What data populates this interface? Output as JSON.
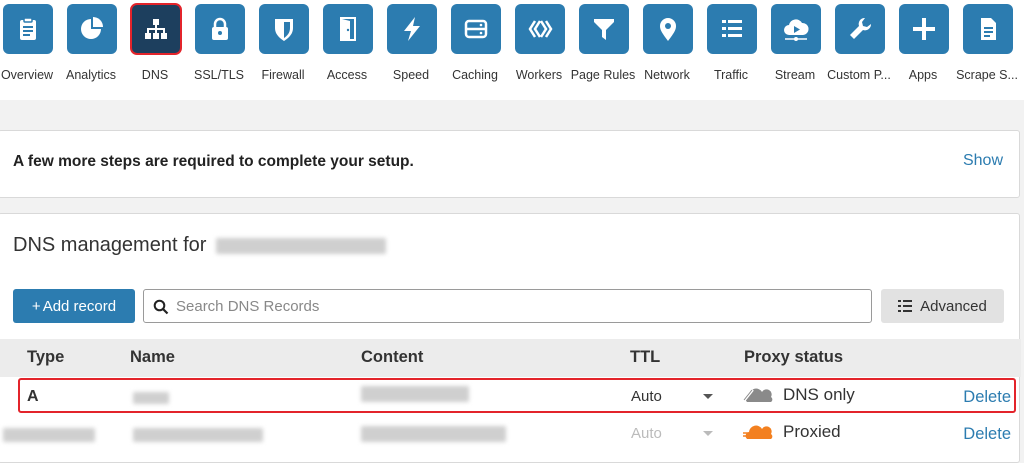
{
  "nav": {
    "items": [
      {
        "label": "Overview",
        "icon": "clipboard-icon"
      },
      {
        "label": "Analytics",
        "icon": "pie-chart-icon"
      },
      {
        "label": "DNS",
        "icon": "sitemap-icon",
        "active": true
      },
      {
        "label": "SSL/TLS",
        "icon": "lock-icon"
      },
      {
        "label": "Firewall",
        "icon": "shield-icon"
      },
      {
        "label": "Access",
        "icon": "door-icon"
      },
      {
        "label": "Speed",
        "icon": "lightning-icon"
      },
      {
        "label": "Caching",
        "icon": "server-icon"
      },
      {
        "label": "Workers",
        "icon": "workers-icon"
      },
      {
        "label": "Page Rules",
        "icon": "filter-icon"
      },
      {
        "label": "Network",
        "icon": "location-pin-icon"
      },
      {
        "label": "Traffic",
        "icon": "list-icon"
      },
      {
        "label": "Stream",
        "icon": "cloud-play-icon"
      },
      {
        "label": "Custom P...",
        "icon": "wrench-icon"
      },
      {
        "label": "Apps",
        "icon": "plus-icon"
      },
      {
        "label": "Scrape S...",
        "icon": "document-icon"
      }
    ]
  },
  "banner": {
    "text": "A few more steps are required to complete your setup.",
    "show_label": "Show"
  },
  "dns": {
    "title": "DNS management for",
    "add_record_label": "Add record",
    "add_record_plus": "+",
    "search_placeholder": "Search DNS Records",
    "advanced_label": "Advanced",
    "columns": {
      "type": "Type",
      "name": "Name",
      "content": "Content",
      "ttl": "TTL",
      "proxy_status": "Proxy status"
    },
    "rows": [
      {
        "type": "A",
        "ttl": "Auto",
        "proxy_status": "DNS only",
        "delete_label": "Delete"
      },
      {
        "type": "",
        "ttl": "Auto",
        "proxy_status": "Proxied",
        "delete_label": "Delete"
      }
    ]
  },
  "colors": {
    "accent": "#2c7cb0",
    "active_tile": "#1d3f5e",
    "highlight": "#e3242b",
    "proxied_orange": "#f38020",
    "dns_only_gray": "#8a8a8a"
  }
}
